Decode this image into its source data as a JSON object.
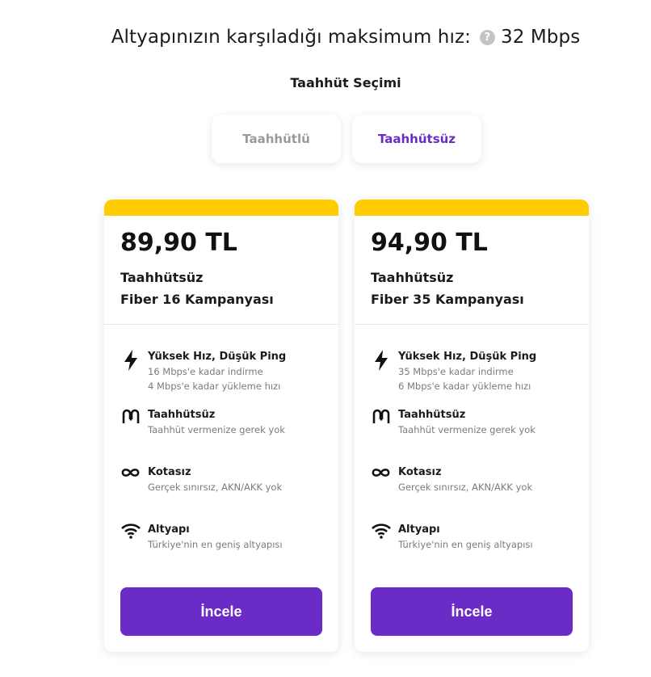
{
  "header": {
    "label": "Altyapınızın karşıladığı maksimum hız:",
    "help_icon": "question-circle-icon",
    "speed": "32 Mbps"
  },
  "commitment": {
    "title": "Taahhüt Seçimi",
    "options": [
      "Taahhütlü",
      "Taahhütsüz"
    ],
    "selected": "Taahhütsüz"
  },
  "colors": {
    "accent": "#6b2bc7",
    "banner": "#ffcc00",
    "inactive": "#9a9a9a"
  },
  "plans": [
    {
      "price": "89,90 TL",
      "name_line1": "Taahhütsüz",
      "name_line2": "Fiber 16 Kampanyası",
      "features": [
        {
          "icon": "lightning-icon",
          "title": "Yüksek Hız, Düşük Ping",
          "lines": [
            "16 Mbps'e kadar indirme",
            "4 Mbps'e kadar yükleme hızı"
          ]
        },
        {
          "icon": "loops-icon",
          "title": "Taahhütsüz",
          "lines": [
            "Taahhüt vermenize gerek yok"
          ]
        },
        {
          "icon": "infinity-icon",
          "title": "Kotasız",
          "lines": [
            "Gerçek sınırsız, AKN/AKK yok"
          ]
        },
        {
          "icon": "wifi-icon",
          "title": "Altyapı",
          "lines": [
            "Türkiye'nin en geniş altyapısı"
          ]
        }
      ],
      "cta": "İncele"
    },
    {
      "price": "94,90 TL",
      "name_line1": "Taahhütsüz",
      "name_line2": "Fiber 35 Kampanyası",
      "features": [
        {
          "icon": "lightning-icon",
          "title": "Yüksek Hız, Düşük Ping",
          "lines": [
            "35 Mbps'e kadar indirme",
            "6 Mbps'e kadar yükleme hızı"
          ]
        },
        {
          "icon": "loops-icon",
          "title": "Taahhütsüz",
          "lines": [
            "Taahhüt vermenize gerek yok"
          ]
        },
        {
          "icon": "infinity-icon",
          "title": "Kotasız",
          "lines": [
            "Gerçek sınırsız, AKN/AKK yok"
          ]
        },
        {
          "icon": "wifi-icon",
          "title": "Altyapı",
          "lines": [
            "Türkiye'nin en geniş altyapısı"
          ]
        }
      ],
      "cta": "İncele"
    }
  ]
}
